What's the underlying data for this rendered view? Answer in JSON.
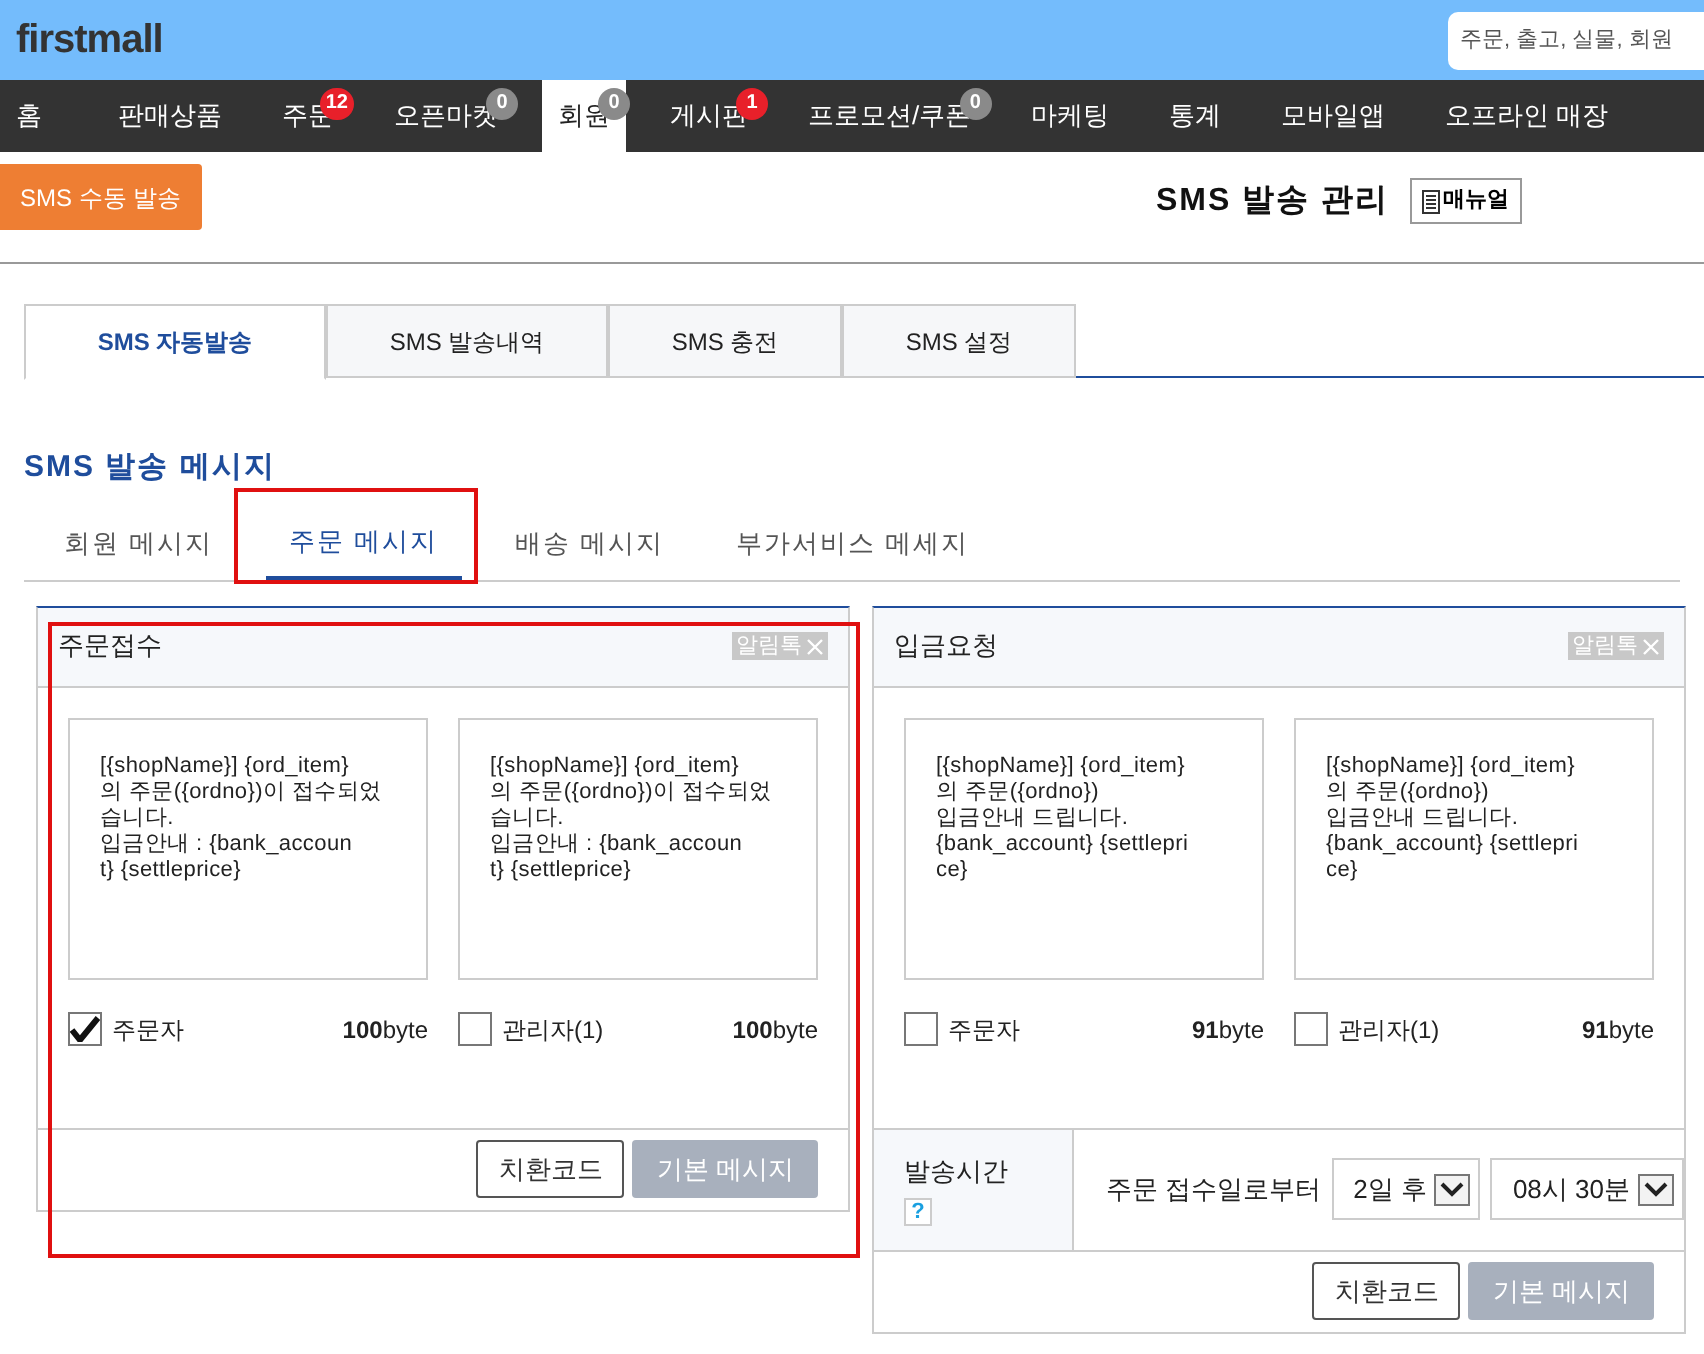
{
  "header": {
    "logo": "firstmall",
    "search": {
      "placeholder": "주문, 출고, 실물, 회원"
    }
  },
  "nav": [
    {
      "label": "홈",
      "selected": false
    },
    {
      "label": "판매상품",
      "selected": false
    },
    {
      "label": "주문",
      "badge": {
        "text": "12",
        "color": "#e8202a"
      },
      "selected": false
    },
    {
      "label": "오픈마켓",
      "badge": {
        "text": "0",
        "color": "#8a8a8a"
      },
      "selected": false
    },
    {
      "label": "회원",
      "badge": {
        "text": "0",
        "color": "#8a8a8a"
      },
      "selected": true
    },
    {
      "label": "게시판",
      "badge": {
        "text": "1",
        "color": "#e8202a"
      },
      "selected": false
    },
    {
      "label": "프로모션/쿠폰",
      "badge": {
        "text": "0",
        "color": "#8a8a8a"
      },
      "selected": false
    },
    {
      "label": "마케팅",
      "selected": false
    },
    {
      "label": "통계",
      "selected": false
    },
    {
      "label": "모바일앱",
      "selected": false
    },
    {
      "label": "오프라인 매장",
      "selected": false
    }
  ],
  "toolbar": {
    "send_button": "SMS 수동 발송",
    "page_title": "SMS 발송 관리",
    "manual_button": "매뉴얼"
  },
  "tabs": [
    {
      "label": "SMS 자동발송",
      "selected": true
    },
    {
      "label": "SMS 발송내역",
      "selected": false
    },
    {
      "label": "SMS 충전",
      "selected": false
    },
    {
      "label": "SMS 설정",
      "selected": false
    }
  ],
  "section_title": "SMS 발송 메시지",
  "subtabs": [
    {
      "label": "회원 메시지",
      "selected": false,
      "highlighted": false
    },
    {
      "label": "주문 메시지",
      "selected": true,
      "highlighted": true
    },
    {
      "label": "배송 메시지",
      "selected": false,
      "highlighted": false
    },
    {
      "label": "부가서비스 메세지",
      "selected": false,
      "highlighted": false
    }
  ],
  "cards": [
    {
      "title": "주문접수",
      "tag": "알림톡",
      "highlighted": true,
      "messages": [
        {
          "lines": [
            "[{shopName}] {ord_item}",
            "의 주문({ordno})이 접수되었",
            "습니다.",
            "입금안내 : {bank_accoun",
            "t} {settleprice}"
          ],
          "recipient": "주문자",
          "checked": true,
          "bytes": "100",
          "unit": "byte"
        },
        {
          "lines": [
            "[{shopName}] {ord_item}",
            "의 주문({ordno})이 접수되었",
            "습니다.",
            "입금안내 : {bank_accoun",
            "t} {settleprice}"
          ],
          "recipient": "관리자(1)",
          "checked": false,
          "bytes": "100",
          "unit": "byte"
        }
      ],
      "buttons": [
        "치환코드",
        "기본 메시지"
      ]
    },
    {
      "title": "입금요청",
      "tag": "알림톡",
      "highlighted": false,
      "messages": [
        {
          "lines": [
            "[{shopName}] {ord_item}",
            "의 주문({ordno})",
            "입금안내 드립니다.",
            "{bank_account} {settlepri",
            "ce}"
          ],
          "recipient": "주문자",
          "checked": false,
          "bytes": "91",
          "unit": "byte"
        },
        {
          "lines": [
            "[{shopName}] {ord_item}",
            "의 주문({ordno})",
            "입금안내 드립니다.",
            "{bank_account} {settlepri",
            "ce}"
          ],
          "recipient": "관리자(1)",
          "checked": false,
          "bytes": "91",
          "unit": "byte"
        }
      ],
      "schedule": {
        "label": "발송시간",
        "help": "?",
        "prefix": "주문 접수일로부터",
        "day": "2일 후",
        "time": "08시 30분"
      },
      "buttons": [
        "치환코드",
        "기본 메시지"
      ]
    }
  ]
}
